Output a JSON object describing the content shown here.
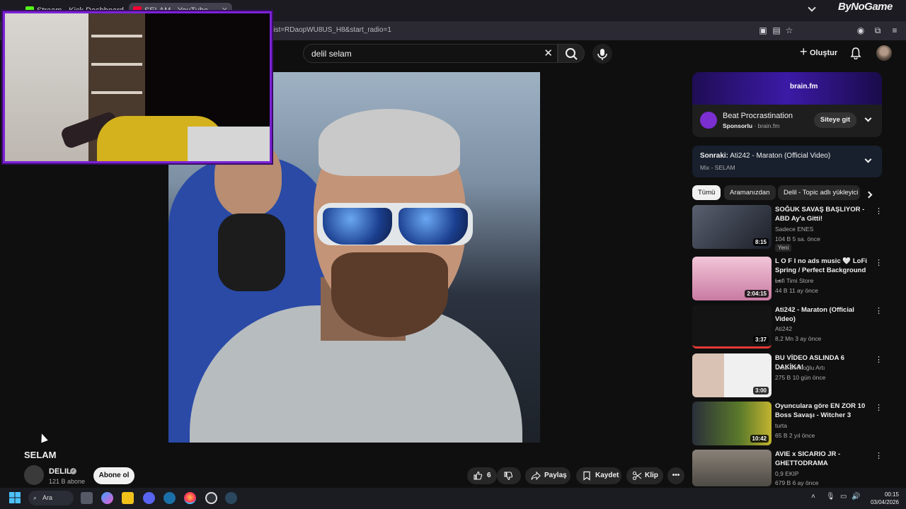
{
  "browser": {
    "tabs": [
      {
        "label": "Stream - Kick Dashboard",
        "favicon_color": "#53fc18"
      },
      {
        "label": "SELAM - YouTube",
        "favicon_color": "#ff0033"
      }
    ],
    "url": "list=RDaopWU8US_H8&start_radio=1",
    "watermark": "ByNoGame"
  },
  "header": {
    "search_value": "delil selam",
    "create_label": "Oluştur"
  },
  "video": {
    "title": "SELAM",
    "channel": "DELIL",
    "subscribers": "121 B abone",
    "subscribe_label": "Abone ol",
    "likes": "6",
    "share_label": "Paylaş",
    "save_label": "Kaydet",
    "clip_label": "Klip"
  },
  "ad": {
    "brand": "brain.fm",
    "title": "Beat Procrastination",
    "sponsored": "Sponsorlu",
    "domain": "brain.fm",
    "cta": "Siteye git"
  },
  "up_next": {
    "prefix": "Sonraki:",
    "title": "Ati242 - Maraton (Official Video)",
    "playlist": "Mix - SELAM"
  },
  "chips": [
    "Tümü",
    "Aramanızdan",
    "Delil - Topic adlı yükleyici"
  ],
  "recommendations": [
    {
      "title": "SOĞUK SAVAŞ BAŞLIYOR - ABD Ay'a Gitti!",
      "channel": "Sadece ENES",
      "meta": "104 B   5 sa. önce",
      "duration": "8:15",
      "badge": "Yeni",
      "thumb_color": "#2a2f3a"
    },
    {
      "title": "L O F I no ads music 🤍 LoFi Spring / Perfect Background ...",
      "channel": "Lofi Timi Store",
      "meta": "44 B   11 ay önce",
      "duration": "2:04:15",
      "badge": "",
      "thumb_color": "#e7a7c4"
    },
    {
      "title": "Ati242 - Maraton (Official Video)",
      "channel": "Ati242",
      "meta": "8,2 Mn   3 ay önce",
      "duration": "3:37",
      "badge": "",
      "thumb_color": "#151515"
    },
    {
      "title": "BU VİDEO ASLINDA 6 DAKİKA!",
      "channel": "Uras Benlioğlu Artı",
      "meta": "275 B   10 gün önce",
      "duration": "3:00",
      "badge": "",
      "thumb_color": "#e9e9e9"
    },
    {
      "title": "Oyunculara göre EN ZOR 10 Boss Savaşı - Witcher 3",
      "channel": "turta",
      "meta": "65 B   2 yıl önce",
      "duration": "10:42",
      "badge": "",
      "thumb_color": "#3c5a2a"
    },
    {
      "title": "AVIE x SICARIO JR - GHETTODRAMA",
      "channel": "0,9 EKIP",
      "meta": "679 B   6 ay önce",
      "duration": "",
      "badge": "",
      "thumb_color": "#6f6a60"
    }
  ],
  "taskbar": {
    "search_label": "Ara",
    "time": "00:15",
    "date": "03/04/2026"
  }
}
